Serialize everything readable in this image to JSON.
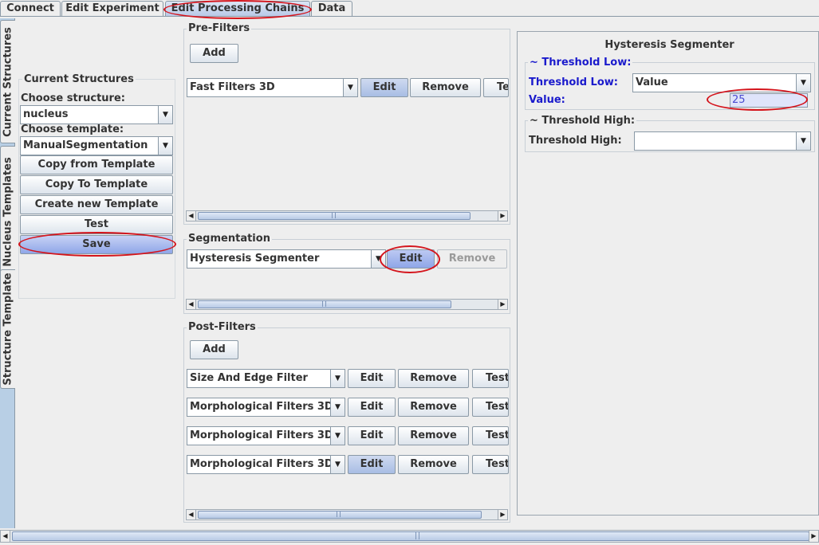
{
  "tabs": [
    "Connect",
    "Edit Experiment",
    "Edit Processing Chains",
    "Data"
  ],
  "side_tabs": [
    "Current Structures",
    "Nucleus Templates",
    "Structure Template"
  ],
  "current_structures": {
    "title": "Current Structures",
    "choose_structure_label": "Choose structure:",
    "structure_value": "nucleus",
    "choose_template_label": "Choose template:",
    "template_value": "ManualSegmentation",
    "buttons": [
      "Copy from Template",
      "Copy To Template",
      "Create new Template",
      "Test",
      "Save"
    ]
  },
  "pre_filters": {
    "title": "Pre-Filters",
    "add_label": "Add",
    "rows": [
      {
        "name": "Fast Filters 3D",
        "edit": "Edit",
        "remove": "Remove",
        "test": "Te"
      }
    ]
  },
  "segmentation": {
    "title": "Segmentation",
    "name": "Hysteresis Segmenter",
    "edit": "Edit",
    "remove": "Remove"
  },
  "post_filters": {
    "title": "Post-Filters",
    "add_label": "Add",
    "rows": [
      {
        "name": "Size And Edge Filter",
        "edit": "Edit",
        "remove": "Remove",
        "test": "Test"
      },
      {
        "name": "Morphological Filters 3D",
        "edit": "Edit",
        "remove": "Remove",
        "test": "Test"
      },
      {
        "name": "Morphological Filters 3D",
        "edit": "Edit",
        "remove": "Remove",
        "test": "Test"
      },
      {
        "name": "Morphological Filters 3D",
        "edit": "Edit",
        "remove": "Remove",
        "test": "Test"
      }
    ]
  },
  "settings": {
    "title": "Hysteresis Segmenter",
    "threshold_low": {
      "group_title": "~ Threshold Low:",
      "label": "Threshold Low:",
      "type_value": "Value",
      "value_label": "Value:",
      "value": "25"
    },
    "threshold_high": {
      "group_title": "~ Threshold High:",
      "label": "Threshold High:",
      "type_value": ""
    }
  },
  "icons": {
    "dropdown": "chevron-down-icon",
    "scroll_left": "arrow-left-icon",
    "scroll_right": "arrow-right-icon"
  },
  "colors": {
    "highlight_ring": "#d4141c",
    "selected_tab": "#b8c8e6",
    "link_label": "#1a1acc"
  }
}
